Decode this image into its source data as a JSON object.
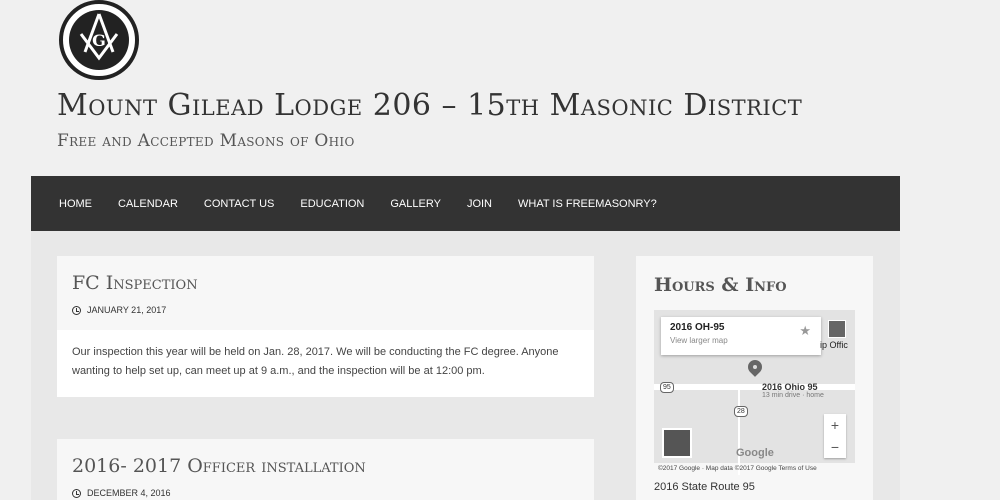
{
  "site": {
    "title": "Mount Gilead Lodge 206 – 15th Masonic District",
    "description": "Free and Accepted Masons of Ohio",
    "logo_letter": "G"
  },
  "nav": {
    "items": [
      {
        "label": "HOME"
      },
      {
        "label": "CALENDAR"
      },
      {
        "label": "CONTACT US"
      },
      {
        "label": "EDUCATION"
      },
      {
        "label": "GALLERY"
      },
      {
        "label": "JOIN"
      },
      {
        "label": "WHAT IS FREEMASONRY?"
      }
    ]
  },
  "posts": [
    {
      "title": "FC Inspection",
      "date": "JANUARY 21, 2017",
      "body": "Our inspection this year will be held on Jan. 28, 2017. We will be conducting the FC degree. Anyone wanting to help set up, can meet up at 9 a.m., and the inspection will be at 12:00 pm."
    },
    {
      "title": "2016- 2017 Officer installation",
      "date": "DECEMBER 4, 2016"
    }
  ],
  "sidebar": {
    "widget_title": "Hours & Info",
    "map": {
      "place": "2016 OH-95",
      "larger_map": "View larger map",
      "pin_label": "2016 Ohio 95",
      "pin_sub": "13 min drive · home",
      "thumb_label": "ip Offic",
      "route_95": "95",
      "route_28": "28",
      "zoom_in": "+",
      "zoom_out": "−",
      "google": "Google",
      "attribution": "©2017 Google · Map data ©2017 Google    Terms of Use"
    },
    "address": "2016 State Route 95"
  },
  "colors": {
    "nav_bg": "#333333",
    "page_bg": "#f0f0f0",
    "content_bg": "#e8e8e8"
  }
}
